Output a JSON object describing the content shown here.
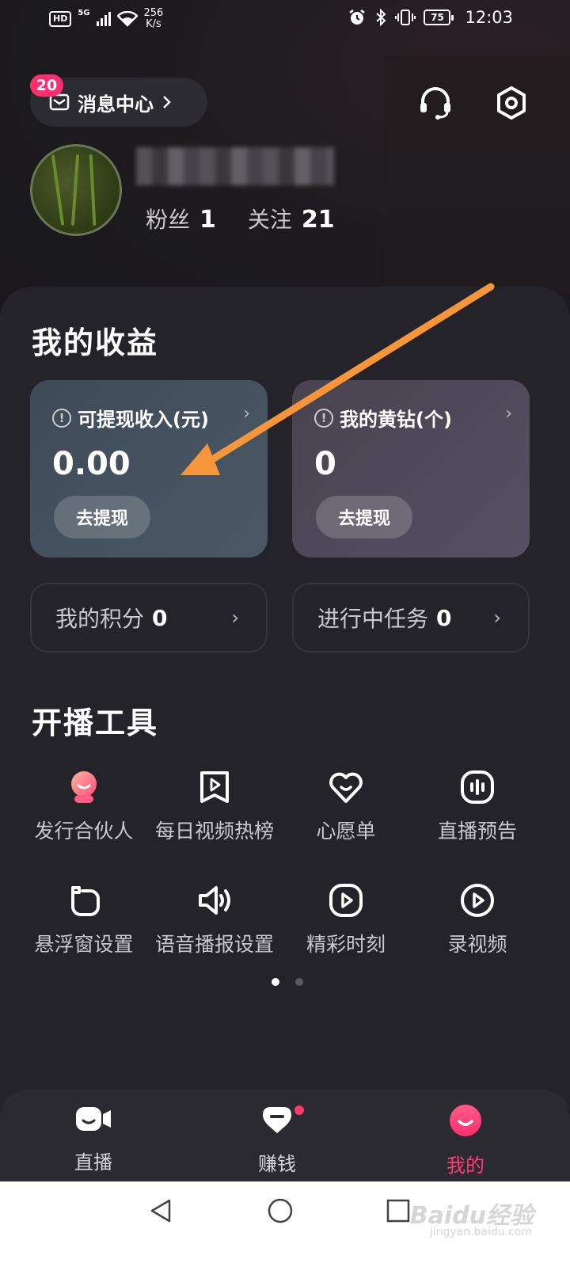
{
  "status_bar": {
    "hd": "HD",
    "network": "5G",
    "speed_value": "256",
    "speed_unit": "K/s",
    "battery": "75",
    "time": "12:03"
  },
  "header": {
    "message_center_label": "消息中心",
    "message_badge": "20",
    "support_icon": "headset-icon",
    "settings_icon": "settings-hexagon-icon"
  },
  "profile": {
    "fans_label": "粉丝",
    "fans_count": "1",
    "following_label": "关注",
    "following_count": "21"
  },
  "earnings": {
    "section_title": "我的收益",
    "withdrawable": {
      "title": "可提现收入(元)",
      "amount": "0.00",
      "button": "去提现"
    },
    "diamonds": {
      "title": "我的黄钻(个)",
      "amount": "0",
      "button": "去提现"
    },
    "points": {
      "label": "我的积分",
      "value": "0"
    },
    "tasks": {
      "label": "进行中任务",
      "value": "0"
    }
  },
  "tools": {
    "section_title": "开播工具",
    "items": [
      {
        "label": "发行合伙人",
        "icon": "partner-mascot-icon"
      },
      {
        "label": "每日视频热榜",
        "icon": "play-bookmark-icon"
      },
      {
        "label": "心愿单",
        "icon": "heart-smile-icon"
      },
      {
        "label": "直播预告",
        "icon": "live-preview-icon"
      },
      {
        "label": "悬浮窗设置",
        "icon": "floating-window-icon"
      },
      {
        "label": "语音播报设置",
        "icon": "speaker-icon"
      },
      {
        "label": "精彩时刻",
        "icon": "highlight-play-icon"
      },
      {
        "label": "录视频",
        "icon": "record-play-icon"
      }
    ],
    "page_indicator": {
      "pages": 2,
      "current": 1
    }
  },
  "bottom_nav": {
    "items": [
      {
        "label": "直播",
        "icon": "video-camera-icon"
      },
      {
        "label": "赚钱",
        "icon": "earn-icon"
      },
      {
        "label": "我的",
        "icon": "profile-smile-icon"
      }
    ],
    "active": "我的"
  },
  "watermark": {
    "brand": "Baidu经验",
    "url": "jingyan.baidu.com"
  },
  "colors": {
    "accent": "#ff3c7a",
    "badge": "#ff2e6f",
    "annotation_arrow": "#f7953b",
    "background": "#1d1c21"
  }
}
